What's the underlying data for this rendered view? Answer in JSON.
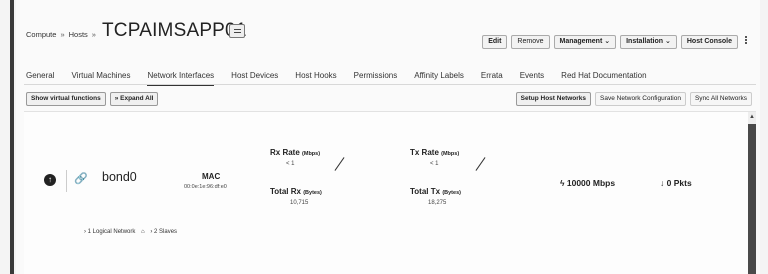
{
  "breadcrumb": {
    "items": [
      "Compute",
      "Hosts"
    ],
    "separator": "»"
  },
  "host": {
    "name": "TCPAIMSAPP01"
  },
  "header_actions": {
    "edit": "Edit",
    "remove": "Remove",
    "management": "Management ⌄",
    "installation": "Installation ⌄",
    "host_console": "Host Console"
  },
  "tabs": [
    {
      "label": "General"
    },
    {
      "label": "Virtual Machines"
    },
    {
      "label": "Network Interfaces",
      "active": true
    },
    {
      "label": "Host Devices"
    },
    {
      "label": "Host Hooks"
    },
    {
      "label": "Permissions"
    },
    {
      "label": "Affinity Labels"
    },
    {
      "label": "Errata"
    },
    {
      "label": "Events"
    },
    {
      "label": "Red Hat Documentation"
    }
  ],
  "toolbar": {
    "show_virtual_functions": "Show virtual functions",
    "expand_all": "» Expand All",
    "setup_host_networks": "Setup Host Networks",
    "save_network_configuration": "Save Network Configuration",
    "sync_all_networks": "Sync All Networks"
  },
  "interface": {
    "name": "bond0",
    "mac_label": "MAC",
    "mac_value": "00:0e:1e:96:df:e0",
    "rx_rate_label": "Rx Rate",
    "rx_rate_unit": "(Mbps)",
    "rx_rate_value": "< 1",
    "tx_rate_label": "Tx Rate",
    "tx_rate_unit": "(Mbps)",
    "tx_rate_value": "< 1",
    "total_rx_label": "Total Rx",
    "total_rx_unit": "(Bytes)",
    "total_rx_value": "10,715",
    "total_tx_label": "Total Tx",
    "total_tx_unit": "(Bytes)",
    "total_tx_value": "18,275",
    "speed": "10000 Mbps",
    "drops": "0 Pkts",
    "logical_networks": "1 Logical Network",
    "slaves": "2 Slaves"
  }
}
